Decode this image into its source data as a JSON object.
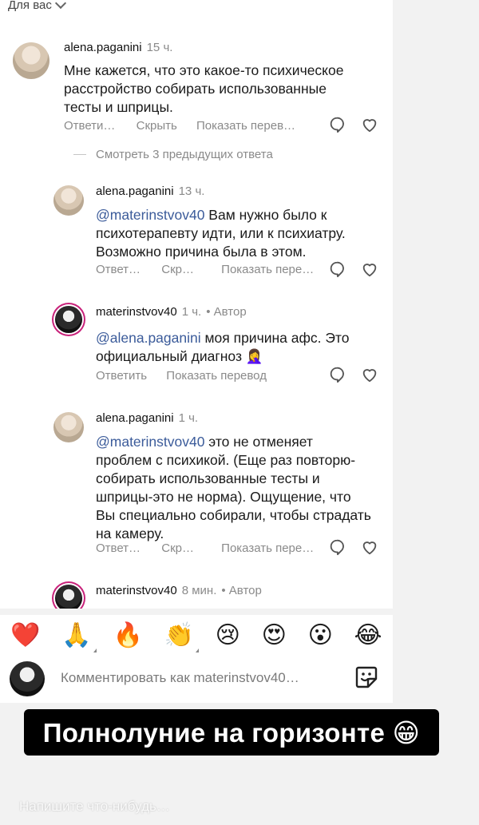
{
  "topbar": {
    "label": "Для вас"
  },
  "comments": [
    {
      "username": "alena.paganini",
      "time": "15 ч.",
      "author_label": "",
      "mention": "",
      "text": "Мне кажется, что это какое-то психическое расстройство  собирать использованные тесты и шприцы.",
      "actions": {
        "reply": "Ответи…",
        "hide": "Скрыть",
        "translate": "Показать перев…"
      }
    },
    {
      "username": "alena.paganini",
      "time": "13 ч.",
      "author_label": "",
      "mention": "@materinstvov40",
      "text": " Вам нужно было к психотерапевту идти, или к психиатру. Возможно причина была в этом.",
      "actions": {
        "reply": "Ответ…",
        "hide": "Скр…",
        "translate": "Показать пере…"
      }
    },
    {
      "username": "materinstvov40",
      "time": "1 ч.",
      "author_label": "• Автор",
      "mention": "@alena.paganini",
      "text": " моя причина афс. Это официальный диагноз 🤦‍♀️",
      "actions": {
        "reply": "Ответить",
        "hide": "",
        "translate": "Показать перевод"
      }
    },
    {
      "username": "alena.paganini",
      "time": "1 ч.",
      "author_label": "",
      "mention": "@materinstvov40",
      "text": " это не отменяет проблем с психикой. (Еще раз повторю-собирать использованные тесты и шприцы-это не норма). Ощущение, что Вы специально собирали, чтобы страдать на камеру.",
      "actions": {
        "reply": "Ответ…",
        "hide": "Скр…",
        "translate": "Показать пере…"
      }
    },
    {
      "username": "materinstvov40",
      "time": "8 мин.",
      "author_label": "• Автор"
    }
  ],
  "view_more": "Смотреть 3 предыдущих ответа",
  "emojis": [
    "❤️",
    "🙏",
    "🔥",
    "👏",
    "😢",
    "😍",
    "😮",
    "😂"
  ],
  "composer": {
    "placeholder": "Комментировать как materinstvov40…"
  },
  "overlay": {
    "text": "Полнолуние на горизонте 😁"
  },
  "reply_placeholder": "Напишите что-нибудь…",
  "colors": {
    "mention": "#3b5b9a",
    "story_ring": "#c8227a",
    "overlay_bg": "#000000"
  }
}
